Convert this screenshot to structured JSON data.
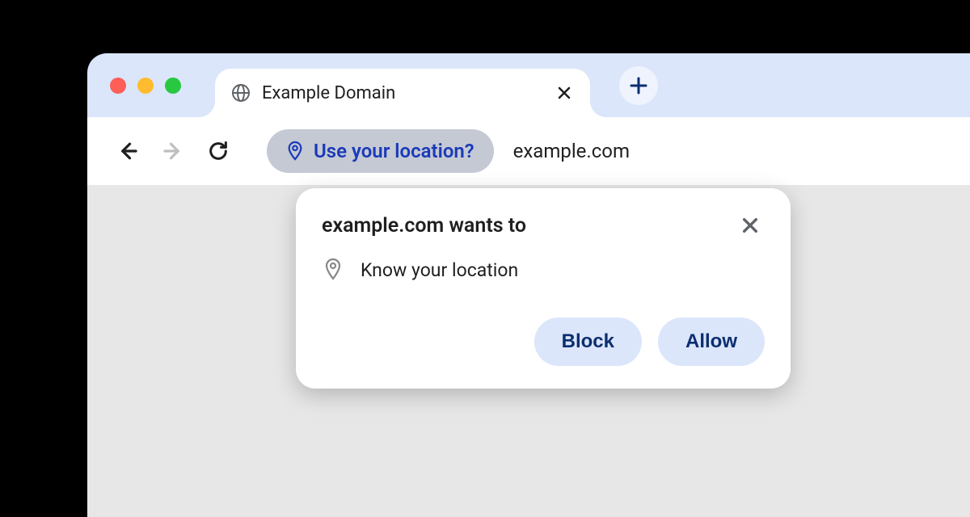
{
  "tab": {
    "title": "Example Domain"
  },
  "address": {
    "url": "example.com",
    "permission_chip": "Use your location?"
  },
  "permission_popup": {
    "title": "example.com wants to",
    "request": "Know your location",
    "block_label": "Block",
    "allow_label": "Allow"
  },
  "colors": {
    "tab_strip": "#dbe6fb",
    "accent": "#1a3ab8",
    "pill_bg": "#dbe6fb",
    "pill_text": "#0b2e6f"
  }
}
